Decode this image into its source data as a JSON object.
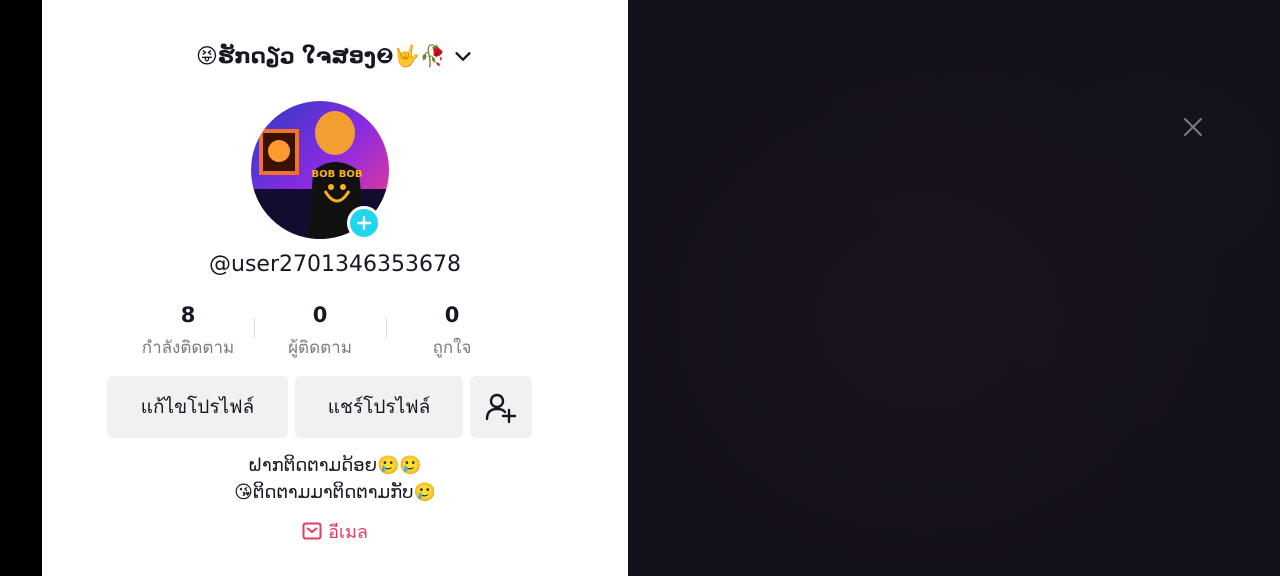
{
  "profile": {
    "display_name": "😝ຮັກດຽວ ໃຈສອງ❷🤟🥀",
    "username": "@user2701346353678",
    "bio_line1": "ຝາກຕິດຕາມດ້ອຍ🥲🥲",
    "bio_line2": "😘ຕິດຕາມມາຕິດຕາມກັບ🥲",
    "email_label": "อีเมล",
    "avatar_text": "BOB BOB"
  },
  "stats": [
    {
      "value": "8",
      "label": "กำลังติดตาม"
    },
    {
      "value": "0",
      "label": "ผู้ติดตาม"
    },
    {
      "value": "0",
      "label": "ถูกใจ"
    }
  ],
  "actions": {
    "edit_profile": "แก้ไขโปรไฟล์",
    "share_profile": "แชร์โปรไฟล์"
  },
  "colors": {
    "accent_cyan": "#20d5ec",
    "link_red": "#e23c5e",
    "button_bg": "#f1f1f2"
  }
}
